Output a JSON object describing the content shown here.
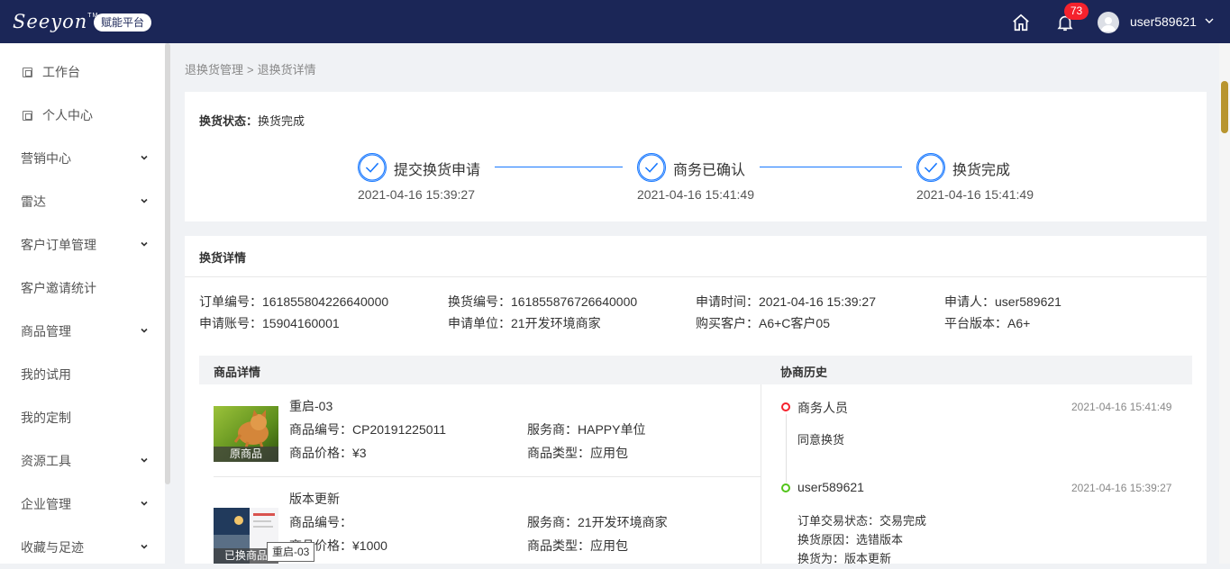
{
  "header": {
    "logo_text": "Seeyon",
    "logo_tm": "TM",
    "platform_badge": "赋能平台",
    "notification_count": "73",
    "username": "user589621",
    "icons": [
      "home-icon",
      "bell-icon",
      "avatar-icon",
      "chevron-down-icon"
    ]
  },
  "sidebar": {
    "items": [
      {
        "label": "工作台",
        "icon": "page-icon"
      },
      {
        "label": "个人中心",
        "icon": "page-icon"
      },
      {
        "label": "营销中心",
        "expandable": true
      },
      {
        "label": "雷达",
        "expandable": true
      },
      {
        "label": "客户订单管理",
        "expandable": true
      },
      {
        "label": "客户邀请统计"
      },
      {
        "label": "商品管理",
        "expandable": true
      },
      {
        "label": "我的试用"
      },
      {
        "label": "我的定制"
      },
      {
        "label": "资源工具",
        "expandable": true
      },
      {
        "label": "企业管理",
        "expandable": true
      },
      {
        "label": "收藏与足迹",
        "expandable": true
      }
    ]
  },
  "breadcrumb": {
    "parent": "退换货管理",
    "separator": ">",
    "current": "退换货详情"
  },
  "status": {
    "label": "换货状态：",
    "value": "换货完成",
    "steps": [
      {
        "title": "提交换货申请",
        "time": "2021-04-16 15:39:27"
      },
      {
        "title": "商务已确认",
        "time": "2021-04-16 15:41:49"
      },
      {
        "title": "换货完成",
        "time": "2021-04-16 15:41:49"
      }
    ],
    "accent": "#1677ff"
  },
  "detail": {
    "title": "换货详情",
    "fields": {
      "order_no": "订单编号：161855804226640000",
      "exchange_no": "换货编号：161855876726640000",
      "apply_time": "申请时间：2021-04-16 15:39:27",
      "applicant": "申请人：user589621",
      "apply_account": "申请账号：15904160001",
      "apply_unit": "申请单位：21开发环境商家",
      "buyer": "购买客户：A6+C客户05",
      "platform_version": "平台版本：A6+"
    },
    "products_header": "商品详情",
    "history_header": "协商历史",
    "products": [
      {
        "name": "重启-03",
        "code": "商品编号：CP20191225011",
        "vendor": "服务商：HAPPY单位",
        "price": "商品价格：¥3",
        "type": "商品类型：应用包",
        "tag": "原商品"
      },
      {
        "name": "版本更新",
        "code": "商品编号：",
        "vendor": "服务商：21开发环境商家",
        "price": "商品价格：¥1000",
        "type": "商品类型：应用包",
        "tag": "已换商品"
      }
    ],
    "tooltip": "重启-03",
    "history": [
      {
        "name": "商务人员",
        "time": "2021-04-16 15:41:49",
        "lines": [
          "同意换货"
        ],
        "dot_color": "#f5222d"
      },
      {
        "name": "user589621",
        "time": "2021-04-16 15:39:27",
        "lines": [
          "订单交易状态：交易完成",
          "换货原因：选错版本",
          "换货为：版本更新"
        ],
        "dot_color": "#52c41a"
      }
    ]
  }
}
